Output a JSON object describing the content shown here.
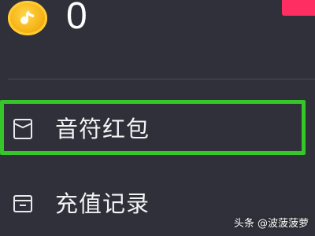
{
  "wallet": {
    "coin_icon": "music-note-coin-icon",
    "balance": "0"
  },
  "menu": {
    "items": [
      {
        "icon": "envelope-icon",
        "label": "音符红包"
      },
      {
        "icon": "receipt-box-icon",
        "label": "充值记录"
      }
    ]
  },
  "watermark": "头条 @波菠菠萝",
  "colors": {
    "background": "#2f3039",
    "highlight": "#35c62a",
    "accent": "#ff2e62",
    "coin": "#f6b417"
  }
}
